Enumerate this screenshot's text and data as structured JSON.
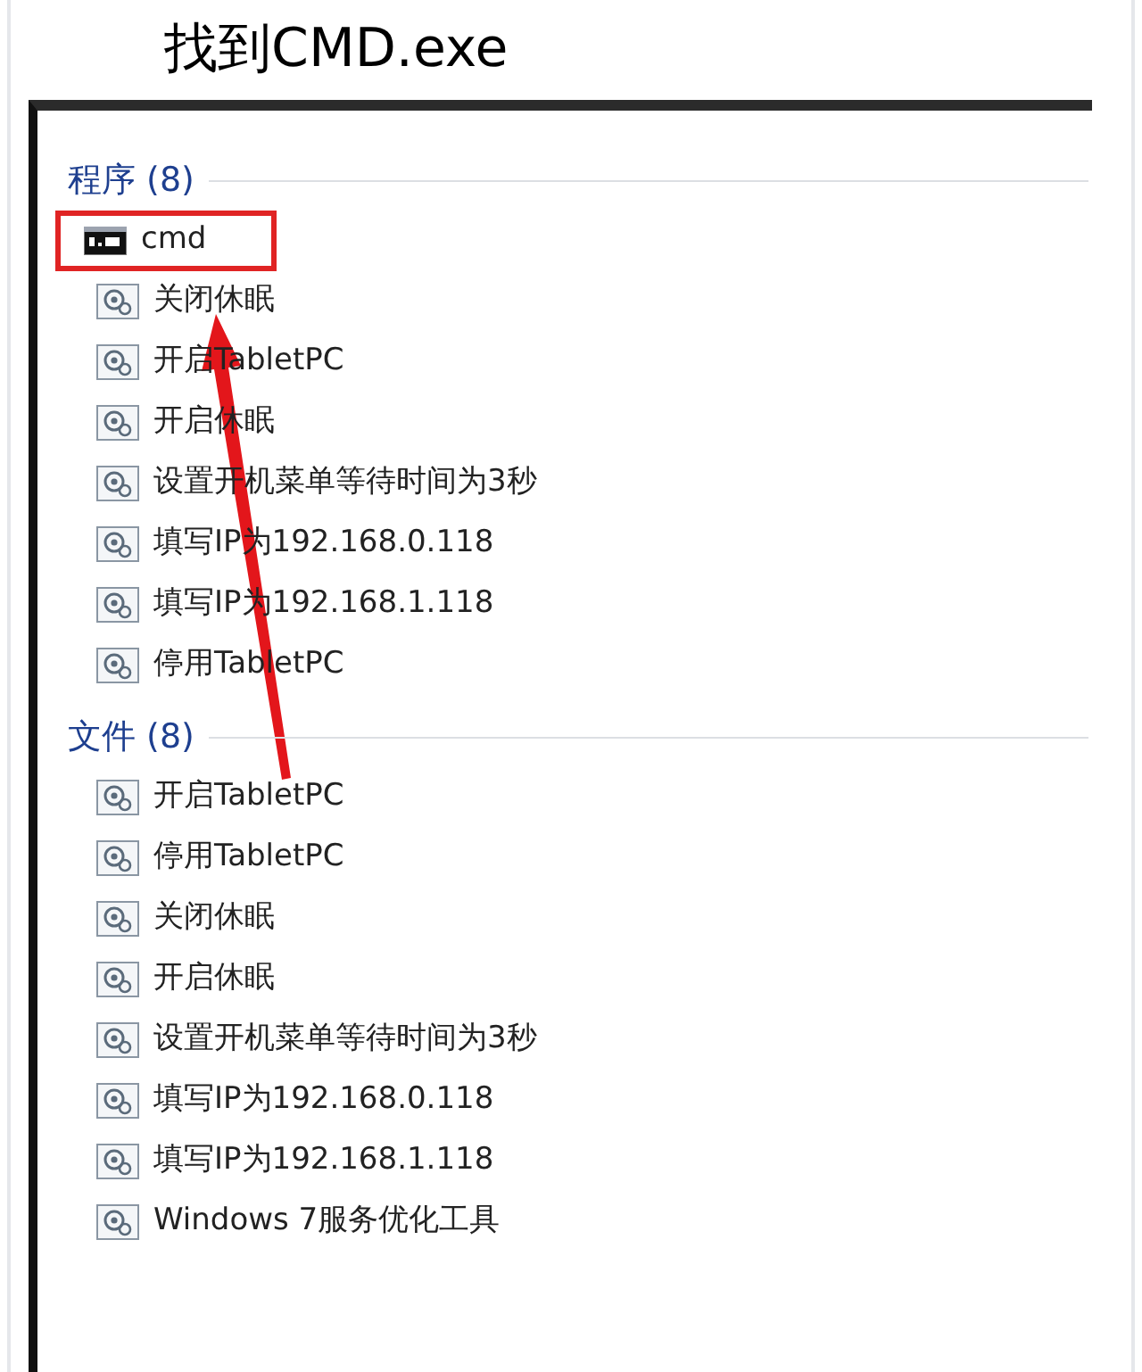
{
  "heading": "找到CMD.exe",
  "sections": [
    {
      "title": "程序 (8)",
      "items": [
        {
          "label": "cmd",
          "kind": "console",
          "highlighted": true
        },
        {
          "label": "关闭休眠",
          "kind": "script",
          "highlighted": false
        },
        {
          "label": "开启TabletPC",
          "kind": "script",
          "highlighted": false
        },
        {
          "label": "开启休眠",
          "kind": "script",
          "highlighted": false
        },
        {
          "label": "设置开机菜单等待时间为3秒",
          "kind": "script",
          "highlighted": false
        },
        {
          "label": "填写IP为192.168.0.118",
          "kind": "script",
          "highlighted": false
        },
        {
          "label": "填写IP为192.168.1.118",
          "kind": "script",
          "highlighted": false
        },
        {
          "label": "停用TabletPC",
          "kind": "script",
          "highlighted": false
        }
      ]
    },
    {
      "title": "文件 (8)",
      "items": [
        {
          "label": "开启TabletPC",
          "kind": "script",
          "highlighted": false
        },
        {
          "label": "停用TabletPC",
          "kind": "script",
          "highlighted": false
        },
        {
          "label": "关闭休眠",
          "kind": "script",
          "highlighted": false
        },
        {
          "label": "开启休眠",
          "kind": "script",
          "highlighted": false
        },
        {
          "label": "设置开机菜单等待时间为3秒",
          "kind": "script",
          "highlighted": false
        },
        {
          "label": "填写IP为192.168.0.118",
          "kind": "script",
          "highlighted": false
        },
        {
          "label": "填写IP为192.168.1.118",
          "kind": "script",
          "highlighted": false
        },
        {
          "label": "Windows 7服务优化工具",
          "kind": "script",
          "highlighted": false
        }
      ]
    }
  ]
}
